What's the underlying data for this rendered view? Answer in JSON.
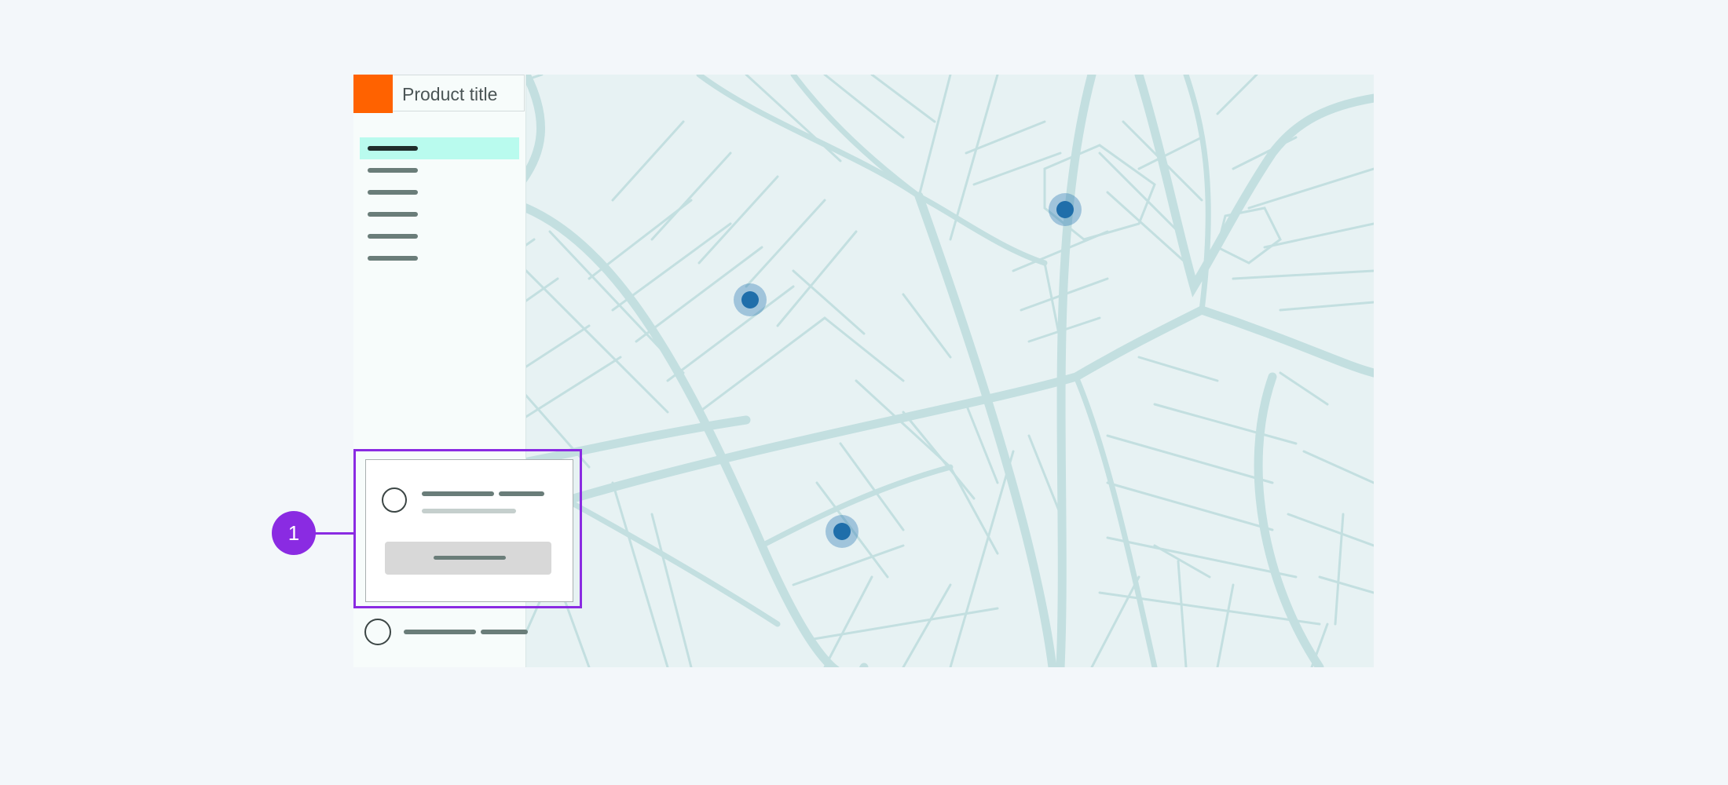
{
  "app": {
    "product_title": "Product title"
  },
  "sidebar": {
    "nav_items": [
      {
        "selected": true
      },
      {
        "selected": false
      },
      {
        "selected": false
      },
      {
        "selected": false
      },
      {
        "selected": false
      },
      {
        "selected": false
      }
    ]
  },
  "annotation": {
    "number": "1"
  },
  "colors": {
    "accent": "#8a2be2",
    "logo": "#ff6200",
    "selected_nav": "#b9fbee",
    "map_bg": "#e7f2f3",
    "map_road": "#c3dfe0",
    "marker": "#1f6eaa"
  },
  "icons": {
    "marker": "map-pin-icon",
    "avatar": "user-avatar-icon"
  }
}
